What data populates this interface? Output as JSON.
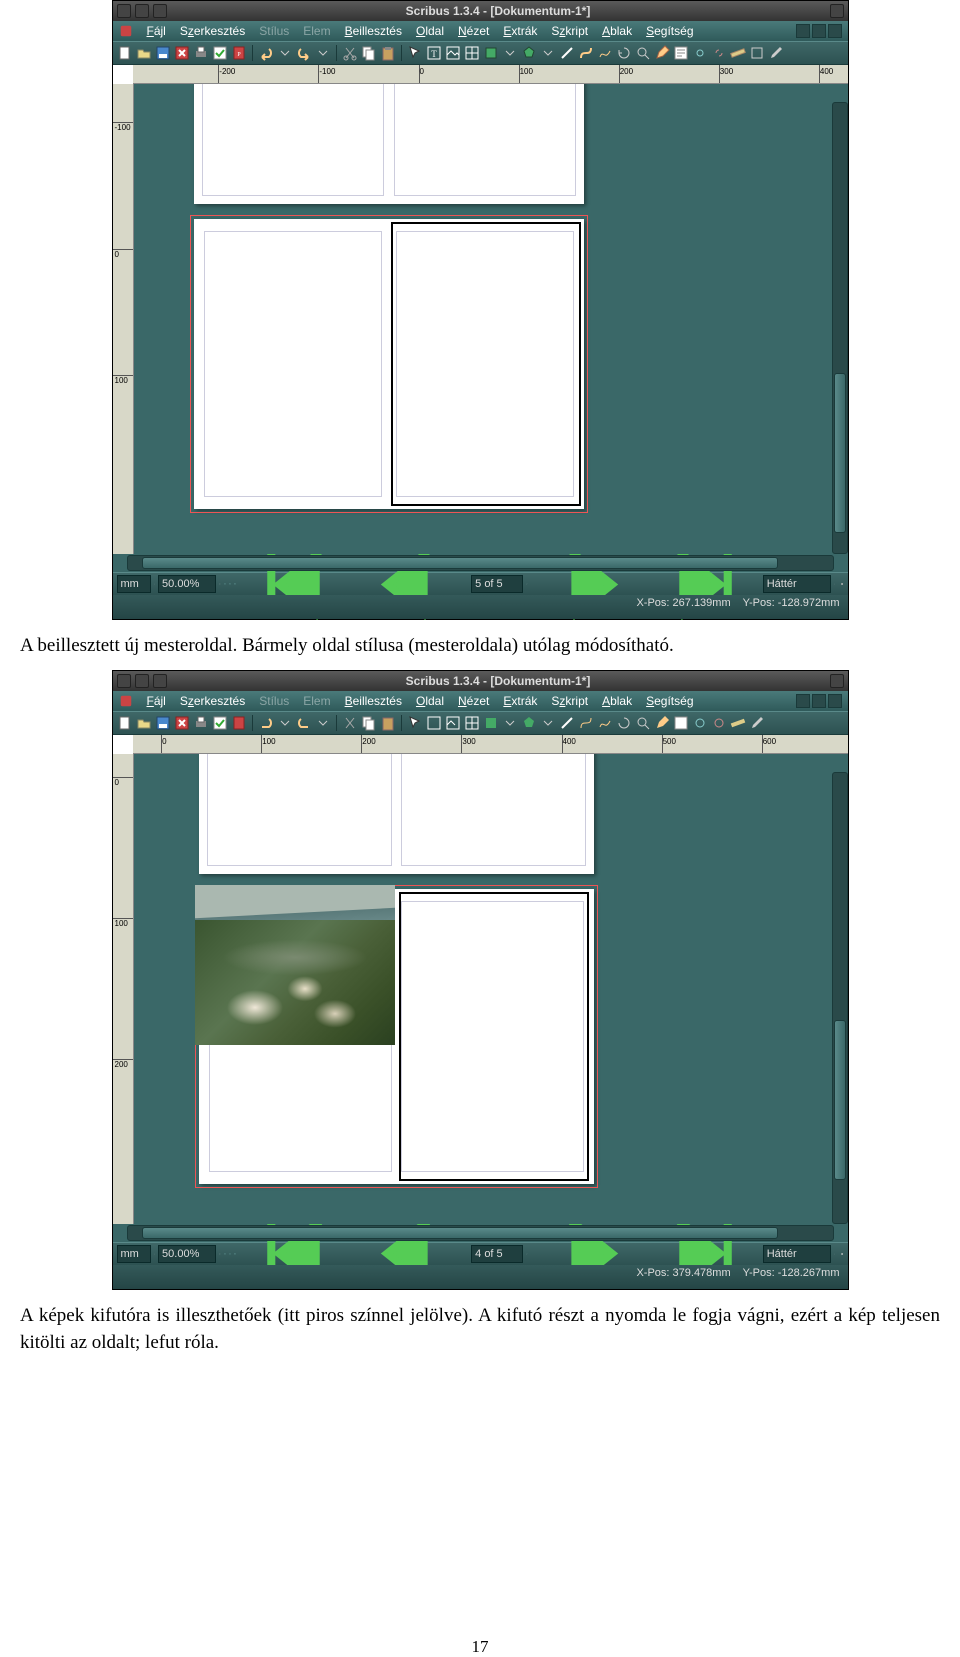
{
  "app": {
    "title1": "Scribus 1.3.4 - [Dokumentum-1*]",
    "title2": "Scribus 1.3.4 - [Dokumentum-1*]"
  },
  "menu": {
    "items": [
      "Fájl",
      "Szerkesztés",
      "Stílus",
      "Elem",
      "Beillesztés",
      "Oldal",
      "Nézet",
      "Extrák",
      "Szkript",
      "Ablak",
      "Segítség"
    ]
  },
  "rulers1": {
    "h": [
      "-200",
      "-100",
      "0",
      "100",
      "200",
      "300",
      "400"
    ],
    "v": [
      "-100",
      "0",
      "100"
    ]
  },
  "rulers2": {
    "h": [
      "0",
      "100",
      "200",
      "300",
      "400",
      "500",
      "600"
    ],
    "v": [
      "0",
      "100",
      "200"
    ]
  },
  "status1": {
    "unit": "mm",
    "zoom": "50.00%",
    "page": "5 of 5",
    "layer": "Háttér",
    "xpos_label": "X-Pos:",
    "xpos": "267.139mm",
    "ypos_label": "Y-Pos:",
    "ypos": "-128.972mm"
  },
  "status2": {
    "unit": "mm",
    "zoom": "50.00%",
    "page": "4 of 5",
    "layer": "Háttér",
    "xpos_label": "X-Pos:",
    "xpos": "379.478mm",
    "ypos_label": "Y-Pos:",
    "ypos": "-128.267mm"
  },
  "text": {
    "para1": "A beillesztett új mesteroldal. Bármely oldal stílusa (mesteroldala) utólag módosítható.",
    "para2": "A képek kifutóra is illeszthetőek (itt piros színnel jelölve). A kifutó részt a nyomda le fogja vágni, ezért a kép teljesen kitölti az oldalt; lefut róla.",
    "pagenum": "17"
  }
}
